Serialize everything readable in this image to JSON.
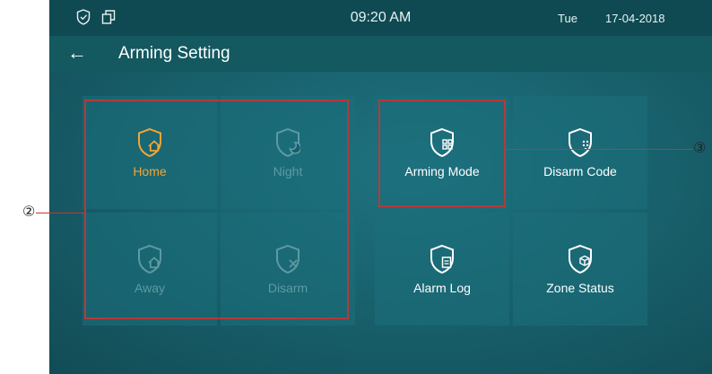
{
  "status_bar": {
    "time": "09:20 AM",
    "day": "Tue",
    "date": "17-04-2018"
  },
  "header": {
    "title": "Arming Setting"
  },
  "arming_modes": [
    {
      "label": "Home",
      "state": "active"
    },
    {
      "label": "Night",
      "state": "inactive"
    },
    {
      "label": "Away",
      "state": "inactive"
    },
    {
      "label": "Disarm",
      "state": "inactive"
    }
  ],
  "settings": [
    {
      "label": "Arming Mode"
    },
    {
      "label": "Disarm Code"
    },
    {
      "label": "Alarm Log"
    },
    {
      "label": "Zone Status"
    }
  ],
  "callouts": {
    "left": "②",
    "right": "③"
  },
  "colors": {
    "active": "#f3a534",
    "inactive": "#5e9aa2",
    "highlight": "#b43a3a"
  }
}
